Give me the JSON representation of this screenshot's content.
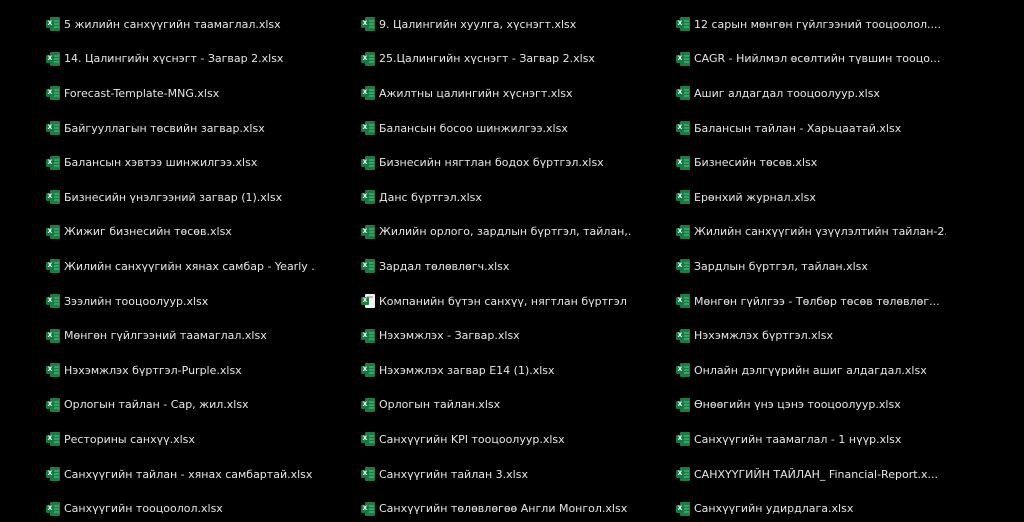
{
  "columns": [
    {
      "items": [
        {
          "name": "5 жилийн санхүүгийн таамаглал.xlsx",
          "icon": "excel-icon"
        },
        {
          "name": "14. Цалингийн хүснэгт - Загвар 2.xlsx",
          "icon": "excel-icon"
        },
        {
          "name": "Forecast-Template-MNG.xlsx",
          "icon": "excel-icon"
        },
        {
          "name": "Байгууллагын төсвийн загвар.xlsx",
          "icon": "excel-icon"
        },
        {
          "name": "Балансын хэвтээ шинжилгээ.xlsx",
          "icon": "excel-icon"
        },
        {
          "name": "Бизнесийн үнэлгээний загвар (1).xlsx",
          "icon": "excel-icon"
        },
        {
          "name": "Жижиг бизнесийн төсөв.xlsx",
          "icon": "excel-icon"
        },
        {
          "name": "Жилийн санхүүгийн хянах самбар - Yearly ...",
          "icon": "excel-icon"
        },
        {
          "name": "Зээлийн тооцоолуур.xlsx",
          "icon": "excel-icon"
        },
        {
          "name": "Мөнгөн гүйлгээний таамаглал.xlsx",
          "icon": "excel-icon"
        },
        {
          "name": "Нэхэмжлэх бүртгэл-Purple.xlsx",
          "icon": "excel-icon"
        },
        {
          "name": "Орлогын тайлан - Сар, жил.xlsx",
          "icon": "excel-icon"
        },
        {
          "name": "Ресторины санхүү.xlsx",
          "icon": "excel-icon"
        },
        {
          "name": "Санхүүгийн тайлан - хянах самбартай.xlsx",
          "icon": "excel-icon"
        },
        {
          "name": "Санхүүгийн тооцоолол.xlsx",
          "icon": "excel-icon"
        }
      ]
    },
    {
      "items": [
        {
          "name": "9. Цалингийн хуулга, хүснэгт.xlsx",
          "icon": "excel-icon"
        },
        {
          "name": "25.Цалингийн хүснэгт - Загвар 2.xlsx",
          "icon": "excel-icon"
        },
        {
          "name": "Ажилтны цалингийн хүснэгт.xlsx",
          "icon": "excel-icon"
        },
        {
          "name": "Балансын босоо шинжилгээ.xlsx",
          "icon": "excel-icon"
        },
        {
          "name": "Бизнесийн нягтлан бодох бүртгэл.xlsx",
          "icon": "excel-icon"
        },
        {
          "name": "Данс бүртгэл.xlsx",
          "icon": "excel-icon"
        },
        {
          "name": "Жилийн орлого, зардлын бүртгэл, тайлан,...",
          "icon": "excel-icon"
        },
        {
          "name": "Зардал төлөвлөгч.xlsx",
          "icon": "excel-icon"
        },
        {
          "name": "Компанийн бүтэн санхүү, нягтлан бүртгэл ...",
          "icon": "excel-file-generic-icon"
        },
        {
          "name": "Нэхэмжлэх - Загвар.xlsx",
          "icon": "excel-icon"
        },
        {
          "name": "Нэхэмжлэх загвар E14 (1).xlsx",
          "icon": "excel-icon"
        },
        {
          "name": "Орлогын тайлан.xlsx",
          "icon": "excel-icon"
        },
        {
          "name": "Санхүүгийн KPI тооцоолуур.xlsx",
          "icon": "excel-icon"
        },
        {
          "name": "Санхүүгийн тайлан 3.xlsx",
          "icon": "excel-icon"
        },
        {
          "name": "Санхүүгийн төлөвлөгөө Англи Монгол.xlsx",
          "icon": "excel-icon"
        }
      ]
    },
    {
      "items": [
        {
          "name": "12 сарын мөнгөн гүйлгээний тооцоолол....",
          "icon": "excel-icon"
        },
        {
          "name": "CAGR - Нийлмэл өсөлтийн түвшин тооцо...",
          "icon": "excel-icon"
        },
        {
          "name": "Ашиг алдагдал тооцоолуур.xlsx",
          "icon": "excel-icon"
        },
        {
          "name": "Балансын тайлан - Харьцаатай.xlsx",
          "icon": "excel-icon"
        },
        {
          "name": "Бизнесийн төсөв.xlsx",
          "icon": "excel-icon"
        },
        {
          "name": "Ерөнхий журнал.xlsx",
          "icon": "excel-icon"
        },
        {
          "name": "Жилийн санхүүгийн үзүүлэлтийн тайлан-2....",
          "icon": "excel-icon"
        },
        {
          "name": "Зардлын бүртгэл, тайлан.xlsx",
          "icon": "excel-icon"
        },
        {
          "name": "Мөнгөн гүйлгээ - Төлбөр төсөв төлөвлөг...",
          "icon": "excel-icon"
        },
        {
          "name": "Нэхэмжлэх бүртгэл.xlsx",
          "icon": "excel-icon"
        },
        {
          "name": "Онлайн дэлгүүрийн ашиг алдагдал.xlsx",
          "icon": "excel-icon"
        },
        {
          "name": "Өнөөгийн үнэ цэнэ тооцоолуур.xlsx",
          "icon": "excel-icon"
        },
        {
          "name": "Санхүүгийн таамаглал - 1 нүүр.xlsx",
          "icon": "excel-icon"
        },
        {
          "name": "САНХҮҮГИЙН ТАЙЛАН_ Financial-Report.x...",
          "icon": "excel-icon"
        },
        {
          "name": "Санхүүгийн удирдлага.xlsx",
          "icon": "excel-icon"
        }
      ]
    }
  ],
  "colors": {
    "background": "#000000",
    "text": "#e6e6e6",
    "excel_green": "#107c41"
  }
}
